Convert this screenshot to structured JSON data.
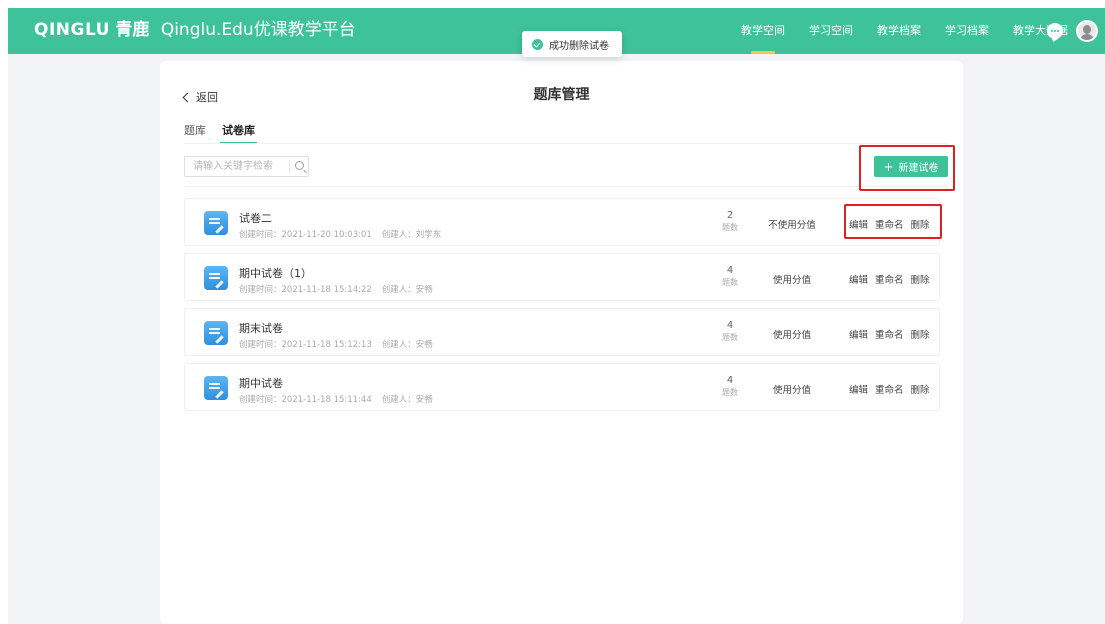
{
  "header": {
    "brand_en": "QINGLU",
    "brand_cn": "青鹿",
    "brand_platform": "Qinglu.Edu优课教学平台",
    "nav": [
      {
        "label": "教学空间",
        "active": true
      },
      {
        "label": "学习空间",
        "active": false
      },
      {
        "label": "教学档案",
        "active": false
      },
      {
        "label": "学习档案",
        "active": false
      },
      {
        "label": "教学大数据",
        "active": false
      }
    ],
    "chat_icon": "chat-bubble-icon",
    "avatar_icon": "user-avatar-icon"
  },
  "toast": {
    "message": "成功删除试卷",
    "icon": "success-check-icon"
  },
  "page": {
    "back_label": "返回",
    "title": "题库管理",
    "tabs": [
      {
        "label": "题库",
        "active": false
      },
      {
        "label": "试卷库",
        "active": true
      }
    ],
    "search_placeholder": "请输入关键字检索",
    "search_value": "",
    "new_button": {
      "icon": "+",
      "label": "新建试卷"
    }
  },
  "papers": [
    {
      "title": "试卷二",
      "created": "创建时间：2021-11-20 10:03:01",
      "creator": "创建人：刘学东",
      "count": "2",
      "count_label": "题数",
      "score_mode": "不使用分值",
      "actions": [
        "编辑",
        "重命名",
        "删除"
      ]
    },
    {
      "title": "期中试卷（1）",
      "created": "创建时间：2021-11-18 15:14:22",
      "creator": "创建人：安畅",
      "count": "4",
      "count_label": "题数",
      "score_mode": "使用分值",
      "actions": [
        "编辑",
        "重命名",
        "删除"
      ]
    },
    {
      "title": "期末试卷",
      "created": "创建时间：2021-11-18 15:12:13",
      "creator": "创建人：安畅",
      "count": "4",
      "count_label": "题数",
      "score_mode": "使用分值",
      "actions": [
        "编辑",
        "重命名",
        "删除"
      ]
    },
    {
      "title": "期中试卷",
      "created": "创建时间：2021-11-18 15:11:44",
      "creator": "创建人：安畅",
      "count": "4",
      "count_label": "题数",
      "score_mode": "使用分值",
      "actions": [
        "编辑",
        "重命名",
        "删除"
      ]
    }
  ],
  "colors": {
    "brand": "#3ec29a",
    "highlight_box": "#e02020",
    "nav_active_underline": "#f5c84b"
  }
}
